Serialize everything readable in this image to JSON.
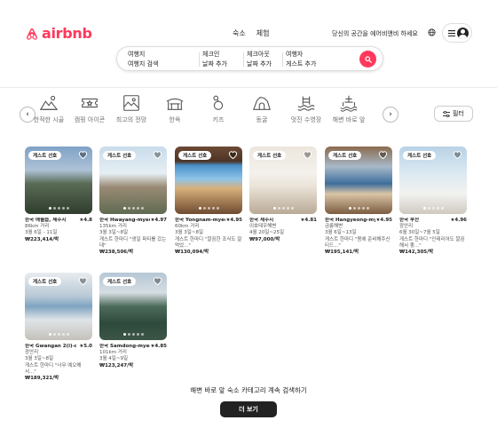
{
  "brand": {
    "name": "airbnb",
    "color": "#ff385c"
  },
  "header": {
    "tabs": [
      "숙소",
      "체험"
    ],
    "host_link": "당신의 공간을 에어비앤비 하세요",
    "globe_icon": "globe-icon",
    "menu_icon": "hamburger-icon"
  },
  "search": {
    "destination_label": "여행지",
    "destination_value": "여행지 검색",
    "checkin_label": "체크인",
    "checkin_value": "날짜 추가",
    "checkout_label": "체크아웃",
    "checkout_value": "날짜 추가",
    "guests_label": "여행자",
    "guests_value": "게스트 추가"
  },
  "categories": [
    {
      "label": "한적한 시골",
      "icon": "countryside-icon"
    },
    {
      "label": "캠핑 아이콘",
      "icon": "ticket-icon"
    },
    {
      "label": "최고의 전망",
      "icon": "view-icon"
    },
    {
      "label": "한옥",
      "icon": "hanok-icon"
    },
    {
      "label": "키즈",
      "icon": "kids-icon"
    },
    {
      "label": "동굴",
      "icon": "cave-icon"
    },
    {
      "label": "멋진 수영장",
      "icon": "pool-icon"
    },
    {
      "label": "해변 바로 앞",
      "icon": "beach-icon"
    }
  ],
  "filter_label": "필터",
  "badge_text": "게스트 선호",
  "listings": [
    {
      "location": "한국 애월읍, 제주시",
      "rating": "★4.8",
      "line1": "86km 거리",
      "line2": "3월 6일 - 11일",
      "price": "₩223,414/박"
    },
    {
      "location": "한국 Hwayang-myeon, Yeosu",
      "rating": "★4.97",
      "line1": "135km 거리",
      "line2": "3월 3일~8일",
      "line3": "게스트 한마디 \"생일 파티를 갔는데\"",
      "price": "₩238,506/박"
    },
    {
      "location": "한국 Yongnam-myeon",
      "rating": "★4.95",
      "line1": "60km 거리",
      "line2": "3월 3일~8일",
      "line3": "게스트 한마디 \"깔끔한 조식도 잘 먹었...\"",
      "price": "₩130,094/박"
    },
    {
      "location": "한국 제주시",
      "rating": "★4.81",
      "line1": "이호테우해변",
      "line2": "4월 20일~25일",
      "price": "₩97,000/박"
    },
    {
      "location": "한국 Hangyeong-myeon, Cheju",
      "rating": "★4.95",
      "line1": "금릉해변",
      "line2": "3월 6일~13일",
      "line3": "게스트 한마디 \"몸에 준비해주신 티드...\"",
      "price": "₩195,141/박"
    },
    {
      "location": "한국 부산",
      "rating": "★4.96",
      "line1": "광안리",
      "line2": "6월 30일~7월 5일",
      "line3": "게스트 한마디 \"인테리어도 깔끔해서 좋...\"",
      "price": "₩142,305/박"
    },
    {
      "location": "한국 Gwangan 2(i)-dong",
      "rating": "★5.0",
      "line1": "광안리",
      "line2": "3월 3일~8일",
      "line3": "게스트 한마디 \"너무 예오해서...\"",
      "price": "₩189,321/박"
    },
    {
      "location": "한국 Samdong-myeon",
      "rating": "★4.85",
      "line1": "101km 거리",
      "line2": "3월 4일~9일",
      "price": "₩123,247/박"
    }
  ],
  "footer": {
    "continue_text": "해변 바로 앞 숙소 카테고리 계속 검색하기",
    "more_button": "더 보기"
  }
}
